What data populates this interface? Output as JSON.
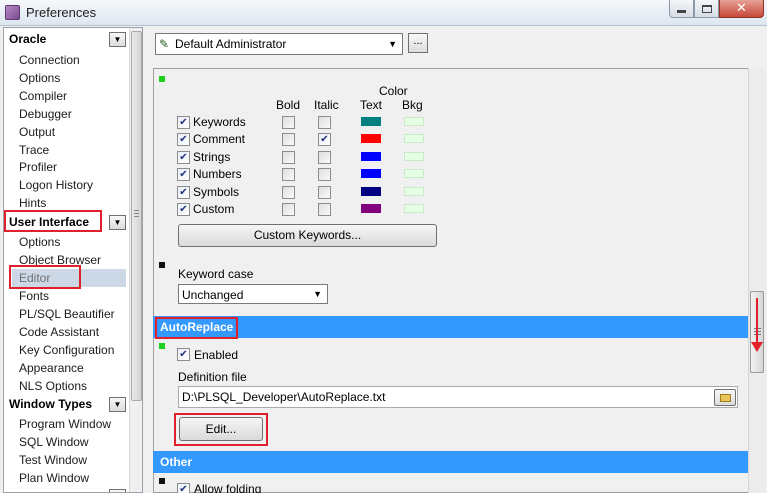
{
  "window": {
    "title": "Preferences"
  },
  "sidebar": {
    "sections": [
      {
        "label": "Oracle",
        "items": [
          "Connection",
          "Options",
          "Compiler",
          "Debugger",
          "Output",
          "Trace",
          "Profiler",
          "Logon History",
          "Hints"
        ]
      },
      {
        "label": "User Interface",
        "items": [
          "Options",
          "Object Browser",
          "Editor",
          "Fonts",
          "PL/SQL Beautifier",
          "Code Assistant",
          "Key Configuration",
          "Appearance",
          "NLS Options"
        ]
      },
      {
        "label": "Window Types",
        "items": [
          "Program Window",
          "SQL Window",
          "Test Window",
          "Plan Window"
        ]
      }
    ],
    "selected": "Editor"
  },
  "profile": {
    "value": "Default Administrator",
    "more_label": "..."
  },
  "syntax": {
    "headers": {
      "bold": "Bold",
      "italic": "Italic",
      "color": "Color",
      "text": "Text",
      "bkg": "Bkg"
    },
    "rows": [
      {
        "label": "Keywords",
        "enabled": true,
        "bold": false,
        "italic": false,
        "text_color": "#008080"
      },
      {
        "label": "Comment",
        "enabled": true,
        "bold": false,
        "italic": true,
        "text_color": "#ff0000"
      },
      {
        "label": "Strings",
        "enabled": true,
        "bold": false,
        "italic": false,
        "text_color": "#0000ff"
      },
      {
        "label": "Numbers",
        "enabled": true,
        "bold": false,
        "italic": false,
        "text_color": "#0000ff"
      },
      {
        "label": "Symbols",
        "enabled": true,
        "bold": false,
        "italic": false,
        "text_color": "#000080"
      },
      {
        "label": "Custom",
        "enabled": true,
        "bold": false,
        "italic": false,
        "text_color": "#800080"
      }
    ],
    "bkg_color": "#e4ffe4",
    "custom_keywords_label": "Custom Keywords..."
  },
  "keyword_case": {
    "label": "Keyword case",
    "value": "Unchanged"
  },
  "autoreplace": {
    "section_label": "AutoReplace",
    "enabled_label": "Enabled",
    "enabled": true,
    "definition_file_label": "Definition file",
    "definition_file_value": "D:\\PLSQL_Developer\\AutoReplace.txt",
    "edit_label": "Edit..."
  },
  "other": {
    "section_label": "Other",
    "allow_folding_label": "Allow folding"
  },
  "colors": {
    "accent": "#3399ff",
    "highlight": "#e0202a",
    "marker_green": "#1ed01e"
  }
}
